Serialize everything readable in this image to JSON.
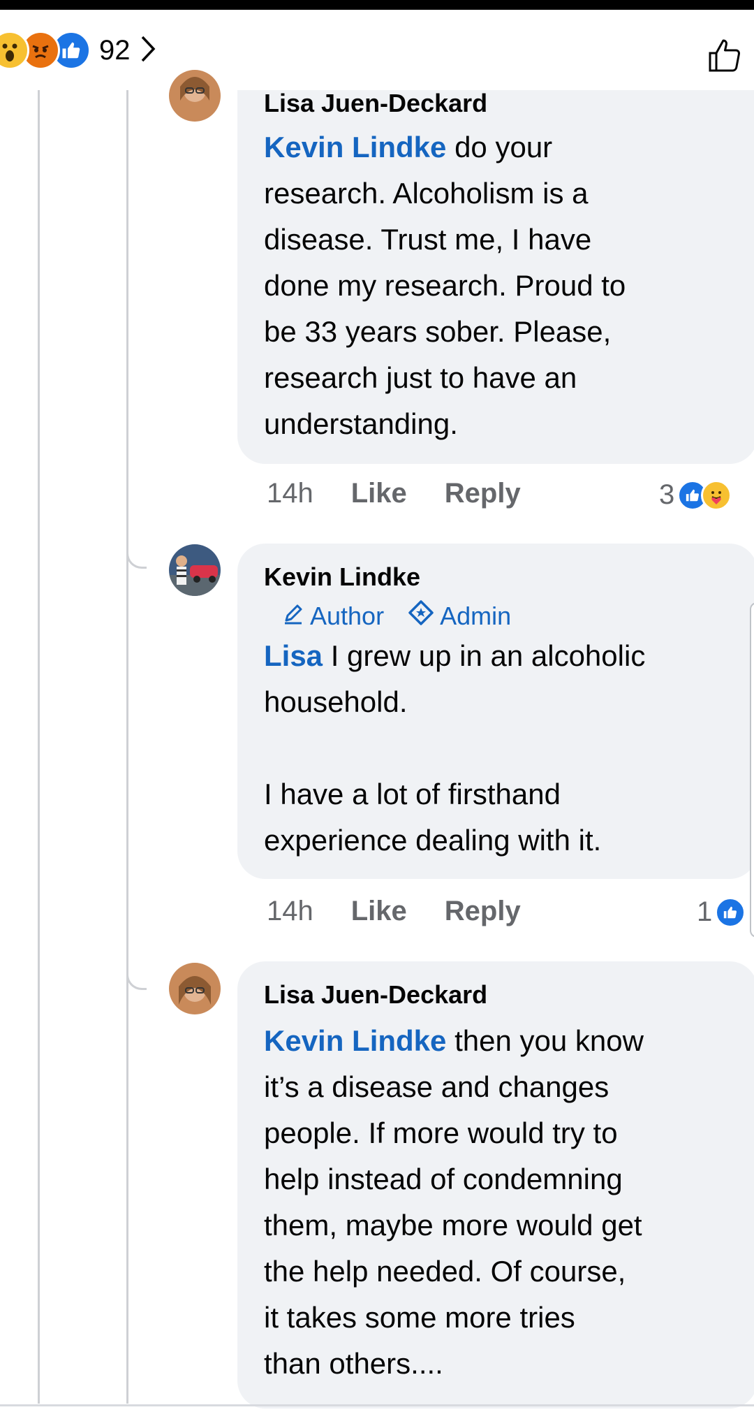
{
  "header": {
    "reaction_count": "92",
    "reactions": [
      "wow",
      "angry",
      "like"
    ]
  },
  "comments": [
    {
      "author": "Lisa Juen-Deckard",
      "mention": "Kevin Lindke",
      "text_lines": [
        " do your",
        "research.  Alcoholism is a",
        "disease.  Trust me, I have",
        "done my research.  Proud to",
        "be 33 years sober.  Please,",
        "research just to have an",
        "understanding."
      ],
      "time": "14h",
      "like_label": "Like",
      "reply_label": "Reply",
      "reaction_count": "3",
      "reaction_icons": [
        "like",
        "care"
      ]
    },
    {
      "author": "Kevin Lindke",
      "badges": [
        "Author",
        "Admin"
      ],
      "mention": "Lisa",
      "text_lines": [
        " I grew up in an alcoholic",
        "household.",
        "",
        "I have a lot of firsthand",
        "experience dealing with it."
      ],
      "time": "14h",
      "like_label": "Like",
      "reply_label": "Reply",
      "reaction_count": "1",
      "reaction_icons": [
        "like"
      ]
    },
    {
      "author": "Lisa Juen-Deckard",
      "mention": "Kevin Lindke",
      "text_lines": [
        " then you know",
        "it’s a disease and changes",
        "people.  If more would try to",
        "help instead of condemning",
        "them, maybe more would get",
        "the help needed.  Of course,",
        "it takes some more tries",
        "than others...."
      ]
    }
  ],
  "colors": {
    "mention": "#1565c0",
    "bubble": "#f0f2f5",
    "meta": "#65676b",
    "like_blue": "#1b74e4"
  },
  "icons": [
    "wow-icon",
    "angry-icon",
    "like-icon",
    "chevron-right-icon",
    "thumbs-up-outline-icon",
    "pencil-icon",
    "admin-diamond-icon",
    "care-icon"
  ]
}
